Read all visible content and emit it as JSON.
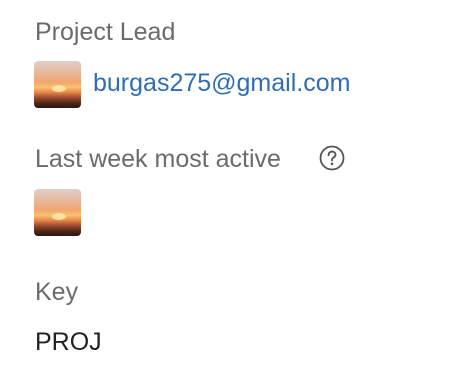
{
  "project_lead": {
    "label": "Project Lead",
    "email": "burgas275@gmail.com",
    "avatar_icon": "user-avatar"
  },
  "most_active": {
    "label": "Last week most active",
    "help_icon": "question-circle-icon",
    "avatar_icon": "user-avatar"
  },
  "key": {
    "label": "Key",
    "value": "PROJ"
  },
  "colors": {
    "label_text": "#6b6b6b",
    "link": "#2f6eb5",
    "value_text": "#222222"
  }
}
